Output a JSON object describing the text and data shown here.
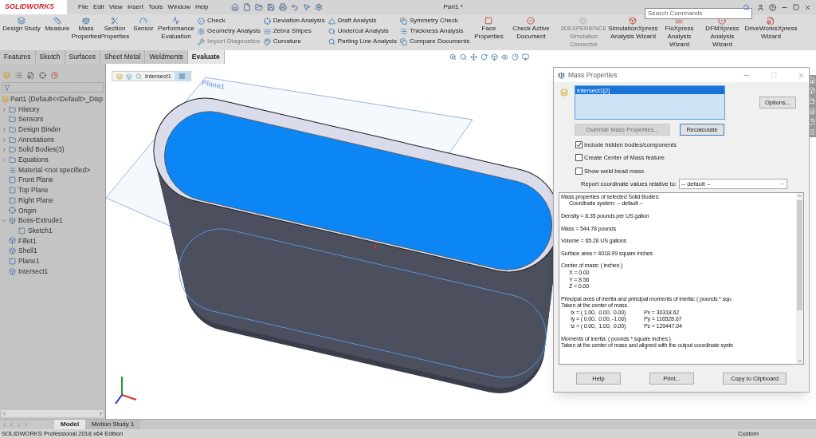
{
  "app": {
    "logo": "SOLIDWORKS",
    "menu": [
      "File",
      "Edit",
      "View",
      "Insert",
      "Tools",
      "Window",
      "Help"
    ],
    "title": "Part1 *",
    "search": {
      "placeholder": "Search Commands"
    }
  },
  "ribbon": {
    "big": [
      {
        "label": "Design Study",
        "kind": "study"
      },
      {
        "label": "Measure",
        "kind": "measure"
      },
      {
        "label": "Mass Properties",
        "kind": "mass"
      },
      {
        "label": "Section Properties",
        "kind": "section"
      },
      {
        "label": "Sensor",
        "kind": "sensor"
      },
      {
        "label": "Performance Evaluation",
        "kind": "performance"
      }
    ],
    "columns": [
      [
        {
          "label": "Check",
          "disabled": false
        },
        {
          "label": "Geometry Analysis",
          "disabled": false
        },
        {
          "label": "Import Diagnostics",
          "disabled": true
        }
      ],
      [
        {
          "label": "Deviation Analysis",
          "disabled": false
        },
        {
          "label": "Zebra Stripes",
          "disabled": false
        },
        {
          "label": "Curvature",
          "disabled": false
        }
      ],
      [
        {
          "label": "Draft Analysis",
          "disabled": false
        },
        {
          "label": "Undercut Analysis",
          "disabled": false
        },
        {
          "label": "Parting Line Analysis",
          "disabled": false
        }
      ],
      [
        {
          "label": "Symmetry Check",
          "disabled": false
        },
        {
          "label": "Thickness Analysis",
          "disabled": false
        },
        {
          "label": "Compare Documents",
          "disabled": false
        }
      ]
    ],
    "tools": [
      {
        "label": "Face Properties",
        "disabled": false
      },
      {
        "label": "Check Active Document",
        "disabled": false
      },
      {
        "label": "3DEXPERIENCE Simulation Connector",
        "disabled": true
      },
      {
        "label": "SimulationXpress Analysis Wizard",
        "disabled": false
      },
      {
        "label": "FloXpress Analysis Wizard",
        "disabled": false
      },
      {
        "label": "DFMXpress Analysis Wizard",
        "disabled": false
      },
      {
        "label": "DriveWorksXpress Wizard",
        "disabled": false
      }
    ]
  },
  "tabs": [
    {
      "label": "Features",
      "selected": false
    },
    {
      "label": "Sketch",
      "selected": false
    },
    {
      "label": "Surfaces",
      "selected": false
    },
    {
      "label": "Sheet Metal",
      "selected": false
    },
    {
      "label": "Weldments",
      "selected": false
    },
    {
      "label": "Evaluate",
      "selected": true
    }
  ],
  "tree": {
    "label": "Part1  (Default<<Default>_Disp",
    "children": [
      {
        "label": "History",
        "kind": "folder",
        "expanded": false
      },
      {
        "label": "Sensors",
        "kind": "folder"
      },
      {
        "label": "Design Binder",
        "kind": "folder",
        "expanded": false
      },
      {
        "label": "Annotations",
        "kind": "folder",
        "expanded": false
      },
      {
        "label": "Solid Bodies(3)",
        "kind": "folder",
        "expanded": false
      },
      {
        "label": "Equations",
        "kind": "folder",
        "expanded": false
      },
      {
        "label": "Material <not specified>",
        "kind": "material"
      },
      {
        "label": "Front Plane",
        "kind": "plane"
      },
      {
        "label": "Top Plane",
        "kind": "plane"
      },
      {
        "label": "Right Plane",
        "kind": "plane"
      },
      {
        "label": "Origin",
        "kind": "origin"
      },
      {
        "label": "Boss-Extrude1",
        "kind": "feature",
        "expanded": true,
        "children": [
          {
            "label": "Sketch1",
            "kind": "sketch"
          }
        ]
      },
      {
        "label": "Fillet1",
        "kind": "feature"
      },
      {
        "label": "Shell1",
        "kind": "feature"
      },
      {
        "label": "Plane1",
        "kind": "plane"
      },
      {
        "label": "Intersect1",
        "kind": "feature"
      }
    ]
  },
  "viewport": {
    "breadcrumb": "Intersect1",
    "plane_label": "Plane1"
  },
  "dialog": {
    "title": "Mass Properties",
    "selection": [
      {
        "label": "Intersect1[2]",
        "selected": true
      }
    ],
    "options": "Options...",
    "override": {
      "label": "Override Mass Properties...",
      "disabled": true
    },
    "recalculate": "Recalculate",
    "checkboxes": [
      {
        "label": "Include hidden bodies/components",
        "checked": true
      },
      {
        "label": "Create Center of Mass feature",
        "checked": false
      },
      {
        "label": "Show weld bead mass",
        "checked": false
      }
    ],
    "report_label": "Report coordinate values relative to:",
    "report_value": "-- default --",
    "results": [
      {
        "lines": [
          "Mass properties of selected Solid Bodies:"
        ],
        "rows": [
          [
            "Coordinate system: -- default --"
          ]
        ]
      },
      {
        "lines": [
          "Density = 8.35 pounds per US gallon"
        ]
      },
      {
        "lines": [
          "Mass = 544.78 pounds"
        ]
      },
      {
        "lines": [
          "Volume = 65.28 US gallons"
        ]
      },
      {
        "lines": [
          "Surface area = 4018.99 square inches"
        ]
      },
      {
        "lines": [
          "Center of mass: ( inches )"
        ],
        "rows": [
          [
            "X = 0.00"
          ],
          [
            "Y = 8.56"
          ],
          [
            "Z = 0.00"
          ]
        ]
      },
      {
        "lines": [
          "Principal axes of inertia and principal moments of inertia: ( pounds * squ",
          "Taken at the center of mass."
        ],
        "rows": [
          [
            "Ix = ( 1.00,  0.00,  0.00)",
            "Px = 30318.62"
          ],
          [
            "Iy = ( 0.00,  0.00, -1.00)",
            "Py = 116528.67"
          ],
          [
            "Iz = ( 0.00,  1.00,  0.00)",
            "Pz = 129447.04"
          ]
        ]
      },
      {
        "lines": [
          "Moments of inertia: ( pounds * square inches )",
          "Taken at the center of mass and aligned with the output coordinate syste"
        ]
      }
    ],
    "buttons": [
      "Help",
      "Print...",
      "Copy to Clipboard"
    ]
  },
  "bottom_tabs": [
    {
      "label": "Model",
      "selected": true
    },
    {
      "label": "Motion Study 1",
      "selected": false
    }
  ],
  "status_bar": {
    "text": "SOLIDWORKS Professional 2018 x64 Edition",
    "units": "Custom"
  }
}
